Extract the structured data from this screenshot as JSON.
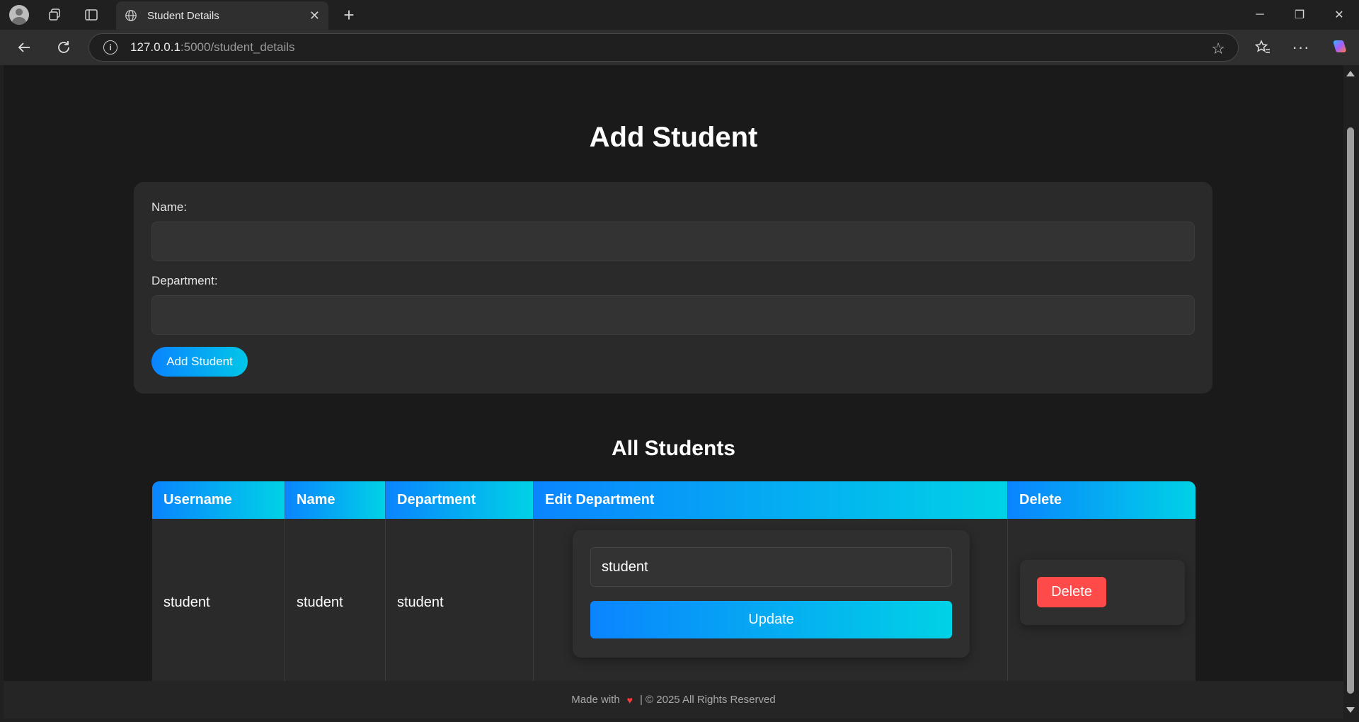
{
  "browser": {
    "tab_title": "Student Details",
    "url_host": "127.0.0.1",
    "url_path": ":5000/student_details"
  },
  "page": {
    "title": "Add Student",
    "form": {
      "name_label": "Name:",
      "name_value": "",
      "department_label": "Department:",
      "department_value": "",
      "submit_label": "Add Student"
    },
    "list_title": "All Students",
    "table": {
      "columns": [
        "Username",
        "Name",
        "Department",
        "Edit Department",
        "Delete"
      ],
      "rows": [
        {
          "username": "student",
          "name": "student",
          "department": "student",
          "edit_value": "student",
          "update_label": "Update",
          "delete_label": "Delete"
        }
      ]
    },
    "footer": {
      "made_with": "Made with",
      "rights": "| © 2025 All Rights Reserved"
    }
  },
  "colors": {
    "accent_start": "#0a84ff",
    "accent_end": "#00d2e6",
    "danger": "#ff4a4a"
  }
}
